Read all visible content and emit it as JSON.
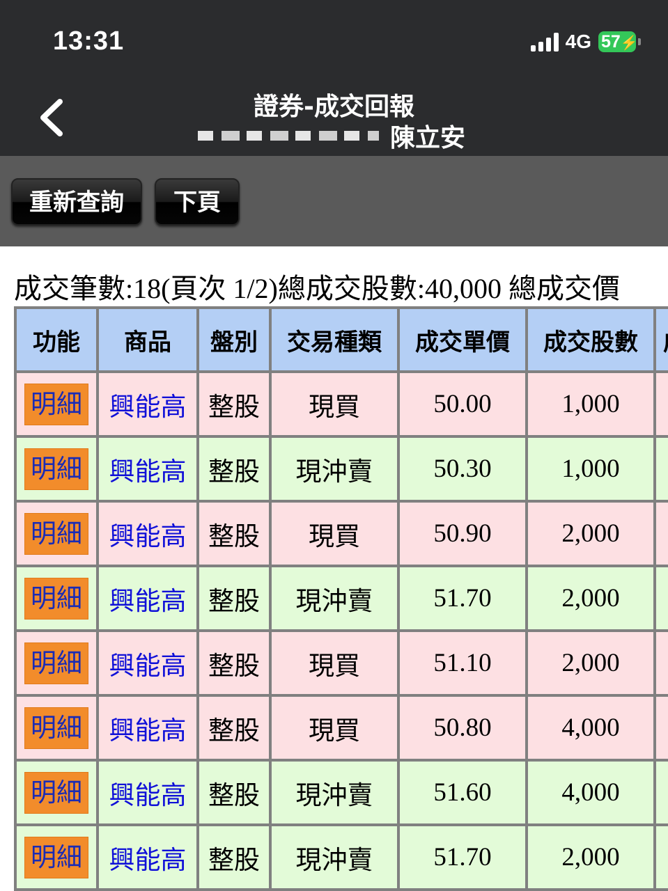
{
  "status_bar": {
    "time": "13:31",
    "network": "4G",
    "battery": "57"
  },
  "nav": {
    "title": "證券-成交回報",
    "account_name": "陳立安"
  },
  "buttons": {
    "requery": "重新查詢",
    "next_page": "下頁"
  },
  "summary": "成交筆數:18(頁次 1/2)總成交股數:40,000 總成交價",
  "table": {
    "headers": [
      "功能",
      "商品",
      "盤別",
      "交易種類",
      "成交單價",
      "成交股數",
      "成"
    ],
    "rows": [
      {
        "action": "明細",
        "product": "興能高",
        "session": "整股",
        "type": "現買",
        "price": "50.00",
        "shares": "1,000",
        "kind": "buy"
      },
      {
        "action": "明細",
        "product": "興能高",
        "session": "整股",
        "type": "現沖賣",
        "price": "50.30",
        "shares": "1,000",
        "kind": "sell"
      },
      {
        "action": "明細",
        "product": "興能高",
        "session": "整股",
        "type": "現買",
        "price": "50.90",
        "shares": "2,000",
        "kind": "buy"
      },
      {
        "action": "明細",
        "product": "興能高",
        "session": "整股",
        "type": "現沖賣",
        "price": "51.70",
        "shares": "2,000",
        "kind": "sell"
      },
      {
        "action": "明細",
        "product": "興能高",
        "session": "整股",
        "type": "現買",
        "price": "51.10",
        "shares": "2,000",
        "kind": "buy"
      },
      {
        "action": "明細",
        "product": "興能高",
        "session": "整股",
        "type": "現買",
        "price": "50.80",
        "shares": "4,000",
        "kind": "buy"
      },
      {
        "action": "明細",
        "product": "興能高",
        "session": "整股",
        "type": "現沖賣",
        "price": "51.60",
        "shares": "4,000",
        "kind": "sell"
      },
      {
        "action": "明細",
        "product": "興能高",
        "session": "整股",
        "type": "現沖賣",
        "price": "51.70",
        "shares": "2,000",
        "kind": "sell"
      }
    ]
  },
  "colors": {
    "header_bg": "#b4cff5",
    "buy_row_bg": "#fde0e3",
    "sell_row_bg": "#e3fbd8",
    "detail_button_bg": "#f28c2b",
    "product_link": "#1010d8"
  }
}
